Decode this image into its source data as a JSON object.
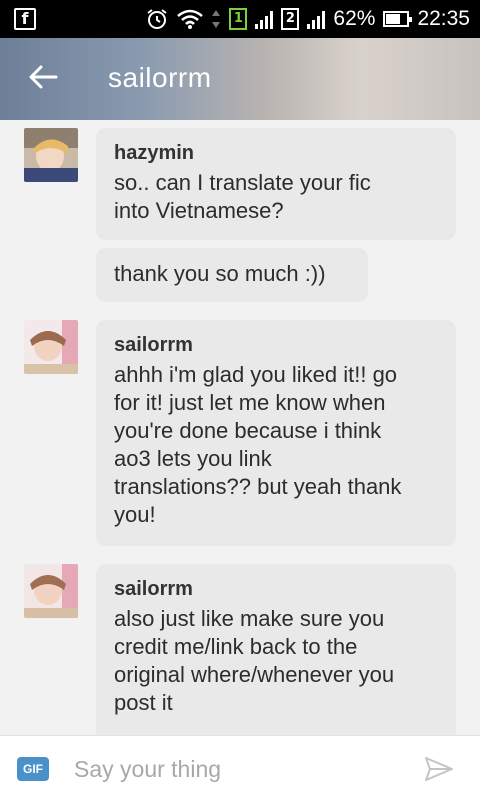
{
  "status_bar": {
    "left_icon": "facebook-icon",
    "sim1": "1",
    "sim2": "2",
    "battery": "62%",
    "time": "22:35"
  },
  "header": {
    "title": "sailorrm",
    "back_icon": "back-arrow-icon"
  },
  "messages": [
    {
      "author": "hazymin",
      "text": "so.. can I translate your fic\ninto Vietnamese?"
    },
    {
      "author": "",
      "text": "thank you so much :))"
    },
    {
      "author": "sailorrm",
      "text": "ahhh i'm glad you liked it!! go\nfor it! just let me know when\nyou're done because i think\nao3 lets you link\ntranslations?? but yeah thank\nyou!"
    },
    {
      "author": "sailorrm",
      "text": "also just like make sure you\ncredit me/link back to the\noriginal where/whenever you\npost it"
    }
  ],
  "input_bar": {
    "gif_label": "GIF",
    "placeholder": "Say your thing",
    "send_icon": "send-icon"
  },
  "colors": {
    "bubble": "#e9e9e9",
    "gif_accent": "#4a90c9",
    "status_green": "#7ad03a"
  }
}
